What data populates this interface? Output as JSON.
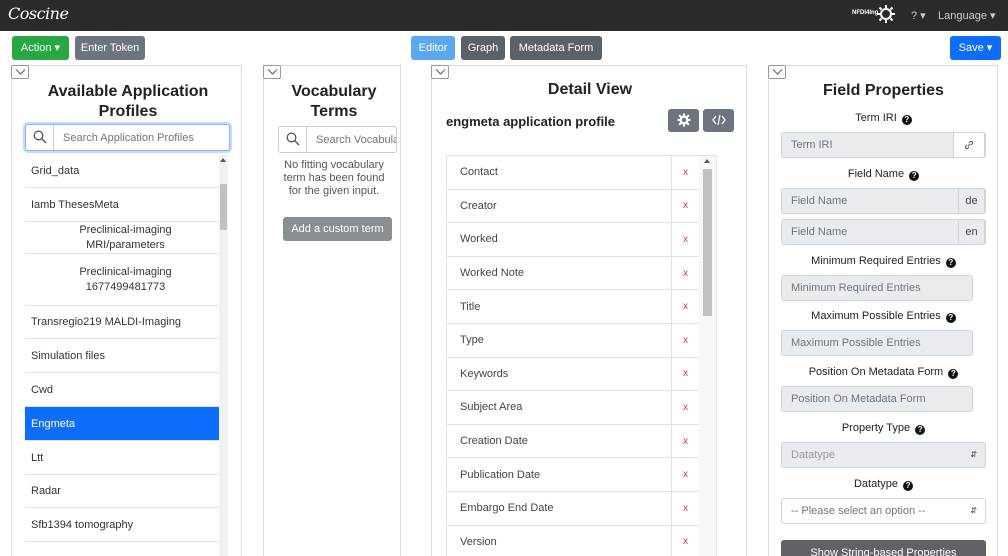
{
  "topbar": {
    "logo": "Coscine",
    "nfdi_label": "NFDI4Ing",
    "help_label": "? ▾",
    "language_label": "Language ▾"
  },
  "toolbar": {
    "action_label": "Action ▾",
    "enter_token_label": "Enter Token",
    "editor_label": "Editor",
    "graph_label": "Graph",
    "metadata_form_label": "Metadata Form",
    "save_label": "Save ▾"
  },
  "profiles_panel": {
    "title": "Available Application Profiles",
    "search_placeholder": "Search Application Profiles",
    "items": [
      {
        "label": "Grid_data",
        "indent": false,
        "active": false
      },
      {
        "label": "Iamb ThesesMeta",
        "indent": false,
        "active": false
      },
      {
        "label": "Preclinical-imaging\nMRI/parameters",
        "indent": true,
        "active": false
      },
      {
        "label": "Preclinical-imaging\n1677499481773",
        "indent": true,
        "active": false
      },
      {
        "label": "Transregio219 MALDI-Imaging",
        "indent": false,
        "active": false
      },
      {
        "label": "Simulation files",
        "indent": false,
        "active": false
      },
      {
        "label": "Cwd",
        "indent": false,
        "active": false
      },
      {
        "label": "Engmeta",
        "indent": false,
        "active": true
      },
      {
        "label": "Ltt",
        "indent": false,
        "active": false
      },
      {
        "label": "Radar",
        "indent": false,
        "active": false
      },
      {
        "label": "Sfb1394 tomography",
        "indent": false,
        "active": false
      }
    ]
  },
  "vocab_panel": {
    "title": "Vocabulary Terms",
    "search_placeholder": "Search Vocabulary Terms",
    "empty_message": "No fitting vocabulary term has been found for the given input.",
    "add_custom_label": "Add a custom term"
  },
  "detail_panel": {
    "title": "Detail View",
    "profile_name": "engmeta application profile",
    "remove_symbol": "x",
    "fields": [
      "Contact",
      "Creator",
      "Worked",
      "Worked Note",
      "Title",
      "Type",
      "Keywords",
      "Subject Area",
      "Creation Date",
      "Publication Date",
      "Embargo End Date",
      "Version"
    ]
  },
  "field_properties": {
    "title": "Field Properties",
    "term_iri_label": "Term IRI",
    "term_iri_placeholder": "Term IRI",
    "field_name_label": "Field Name",
    "field_name_de_placeholder": "Field Name",
    "field_name_de_lang": "de",
    "field_name_en_placeholder": "Field Name",
    "field_name_en_lang": "en",
    "min_entries_label": "Minimum Required Entries",
    "min_entries_placeholder": "Minimum Required Entries",
    "max_entries_label": "Maximum Possible Entries",
    "max_entries_placeholder": "Maximum Possible Entries",
    "position_label": "Position On Metadata Form",
    "position_placeholder": "Position On Metadata Form",
    "property_type_label": "Property Type",
    "property_type_value": "Datatype",
    "datatype_label": "Datatype",
    "datatype_value": "-- Please select an option --",
    "show_string_props_label": "Show String-based Properties",
    "help_symbol": "?"
  },
  "colors": {
    "primary": "#0d6efd",
    "success": "#28a745",
    "secondary": "#6c757d",
    "danger": "#dc3545",
    "topbar": "#2b2b2b"
  }
}
